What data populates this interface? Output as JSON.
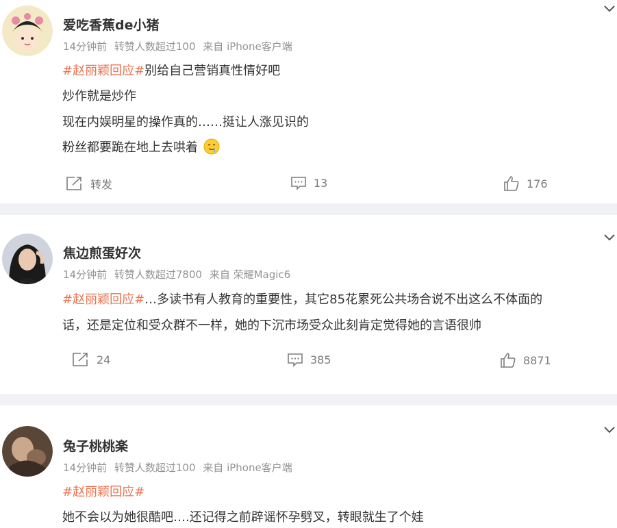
{
  "posts": [
    {
      "user": "爱吃香蕉de小猪",
      "time": "14分钟前",
      "reposts_note": "转赞人数超过100",
      "source": "来自 iPhone客户端",
      "hashtag": "#赵丽颖回应#",
      "lines": [
        "别给自己营销真性情好吧",
        "炒作就是炒作",
        "现在内娱明星的操作真的……挺让人涨见识的",
        "粉丝都要跪在地上去哄着"
      ],
      "repost_label": "转发",
      "comments": "13",
      "likes": "176"
    },
    {
      "user": "焦边煎蛋好次",
      "time": "14分钟前",
      "reposts_note": "转赞人数超过7800",
      "source": "来自 荣耀Magic6",
      "hashtag": "#赵丽颖回应#",
      "lines": [
        "…多读书有人教育的重要性，其它85花累死公共场合说不出这么不体面的",
        "话，还是定位和受众群不一样，她的下沉市场受众此刻肯定觉得她的言语很帅"
      ],
      "repost_label": "24",
      "comments": "385",
      "likes": "8871"
    },
    {
      "user": "兔子桃桃楽",
      "time": "14分钟前",
      "reposts_note": "转赞人数超过100",
      "source": "来自 iPhone客户端",
      "hashtag": "#赵丽颖回应#",
      "lines": [
        "她不会以为她很酷吧….还记得之前辟谣怀孕劈叉，转眼就生了个娃"
      ]
    }
  ],
  "icons": {
    "expand": "chevron-down-icon",
    "repost": "share-icon",
    "comment": "comment-icon",
    "like": "thumbs-up-icon"
  },
  "colors": {
    "hashtag": "#eb7350",
    "meta": "#939393",
    "separator": "#f1f2f5"
  }
}
